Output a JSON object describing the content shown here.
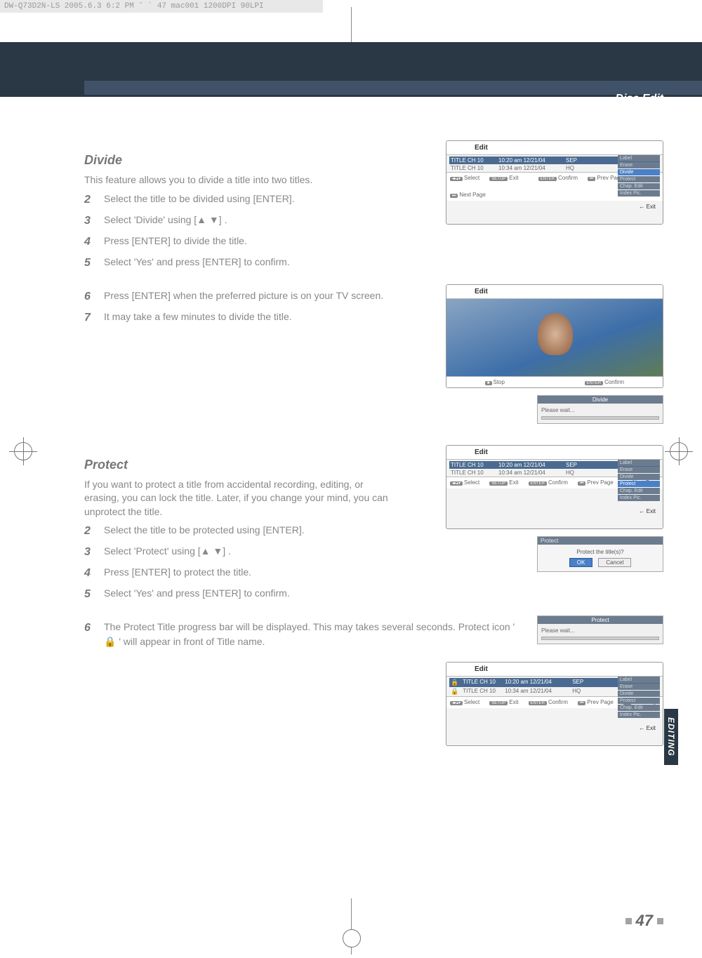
{
  "meta_line": "DW-Q73D2N-LS  2005.6.3 6:2 PM  ˘  `  47   mac001  1200DPI 90LPI",
  "header_title": "Disc Edit",
  "side_tab": "EDITING",
  "page_number": "47",
  "divide": {
    "title": "Divide",
    "intro": "This feature allows you to divide a title into two titles.",
    "steps": {
      "s2": "Select the title to be divided using [ENTER].",
      "s3": "Select 'Divide' using [▲ ▼] .",
      "s4": "Press [ENTER] to divide the title.",
      "s5": "Select 'Yes'  and press [ENTER] to confirm.",
      "s6": "Press [ENTER] when the preferred picture is on your TV screen.",
      "s7": "It may take a few minutes to divide the title."
    }
  },
  "protect": {
    "title": "Protect",
    "intro": "If you want to protect a title from accidental recording, editing, or erasing, you can lock the title. Later, if you change your mind, you can unprotect the title.",
    "steps": {
      "s2": "Select the title to be protected using [ENTER].",
      "s3": "Select 'Protect' using [▲ ▼] .",
      "s4": "Press [ENTER] to protect the title.",
      "s5": "Select 'Yes'  and press [ENTER] to confirm.",
      "s6": "The Protect Title progress bar will be displayed. This may takes several seconds. Protect icon ' 🔒 ' will appear in front of Title name."
    }
  },
  "osd": {
    "edit_label": "Edit",
    "rows": [
      {
        "title": "TITLE CH 10",
        "time": "10:20 am 12/21/04",
        "q": "SEP"
      },
      {
        "title": "TITLE CH 10",
        "time": "10:34 am 12/21/04",
        "q": "HQ"
      }
    ],
    "menu_items": [
      "Label",
      "Erase",
      "Divide",
      "Protect",
      "Chap. Edit",
      "Index Pic."
    ],
    "exit": "Exit",
    "footer_select": "Select",
    "footer_confirm": "Confirm",
    "footer_setup_exit": "Exit",
    "footer_prev": "Prev Page",
    "footer_next": "Next Page",
    "preview_stop": "Stop",
    "preview_confirm": "Confirm",
    "divide_wait_title": "Divide",
    "wait_text": "Please wait...",
    "protect_dialog_title": "Protect",
    "protect_dialog_text": "Protect the title(s)?",
    "ok": "OK",
    "cancel": "Cancel",
    "protect_wait_title": "Protect"
  }
}
